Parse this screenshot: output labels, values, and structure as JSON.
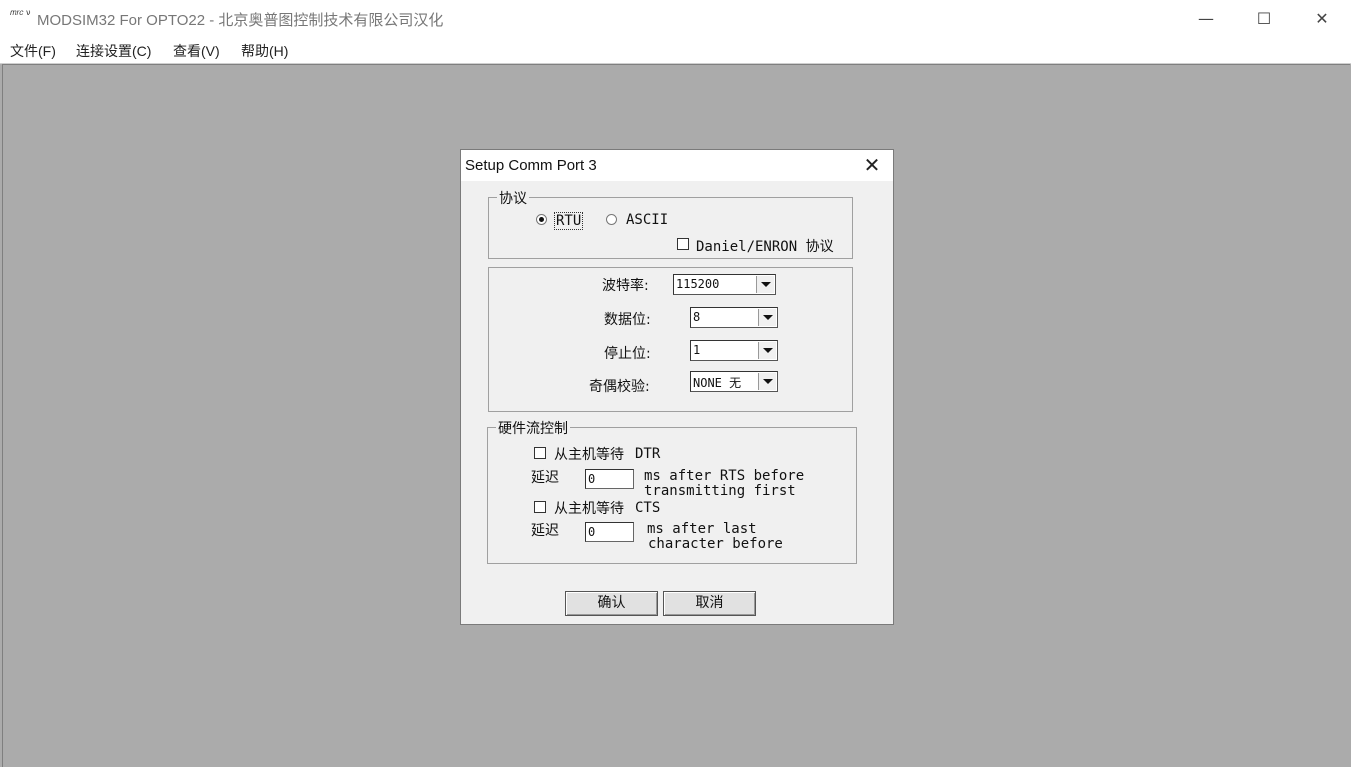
{
  "app": {
    "icon_text": "𝑚𝑟𝑐 ν",
    "title": "MODSIM32 For OPTO22 - 北京奥普图控制技术有限公司汉化",
    "controls": {
      "minimize": "—",
      "maximize": "☐",
      "close": "✕"
    }
  },
  "menu": [
    "文件(F)",
    "连接设置(C)",
    "查看(V)",
    "帮助(H)"
  ],
  "dialog": {
    "title": "Setup Comm Port 3",
    "close": "✕",
    "protocol": {
      "group_label": "协议",
      "rtu_label": "RTU",
      "ascii_label": "ASCII",
      "selected": "RTU",
      "daniel_label": "Daniel/ENRON 协议",
      "daniel_checked": false
    },
    "serial": {
      "baud_label": "波特率:",
      "baud_value": "115200",
      "databits_label": "数据位:",
      "databits_value": "8",
      "stopbits_label": "停止位:",
      "stopbits_value": "1",
      "parity_label": "奇偶校验:",
      "parity_value": "NONE 无"
    },
    "flow": {
      "group_label": "硬件流控制",
      "dtr_label": "从主机等待",
      "dtr_suffix": "DTR",
      "dtr_checked": false,
      "delay_label": "延迟",
      "delay1_value": "0",
      "delay1_text_line1": "ms after RTS before",
      "delay1_text_line2": "transmitting first",
      "cts_label": "从主机等待",
      "cts_suffix": "CTS",
      "cts_checked": false,
      "delay2_value": "0",
      "delay2_text_line1": "ms after last",
      "delay2_text_line2": "character before"
    },
    "buttons": {
      "ok": "确认",
      "cancel": "取消"
    }
  }
}
